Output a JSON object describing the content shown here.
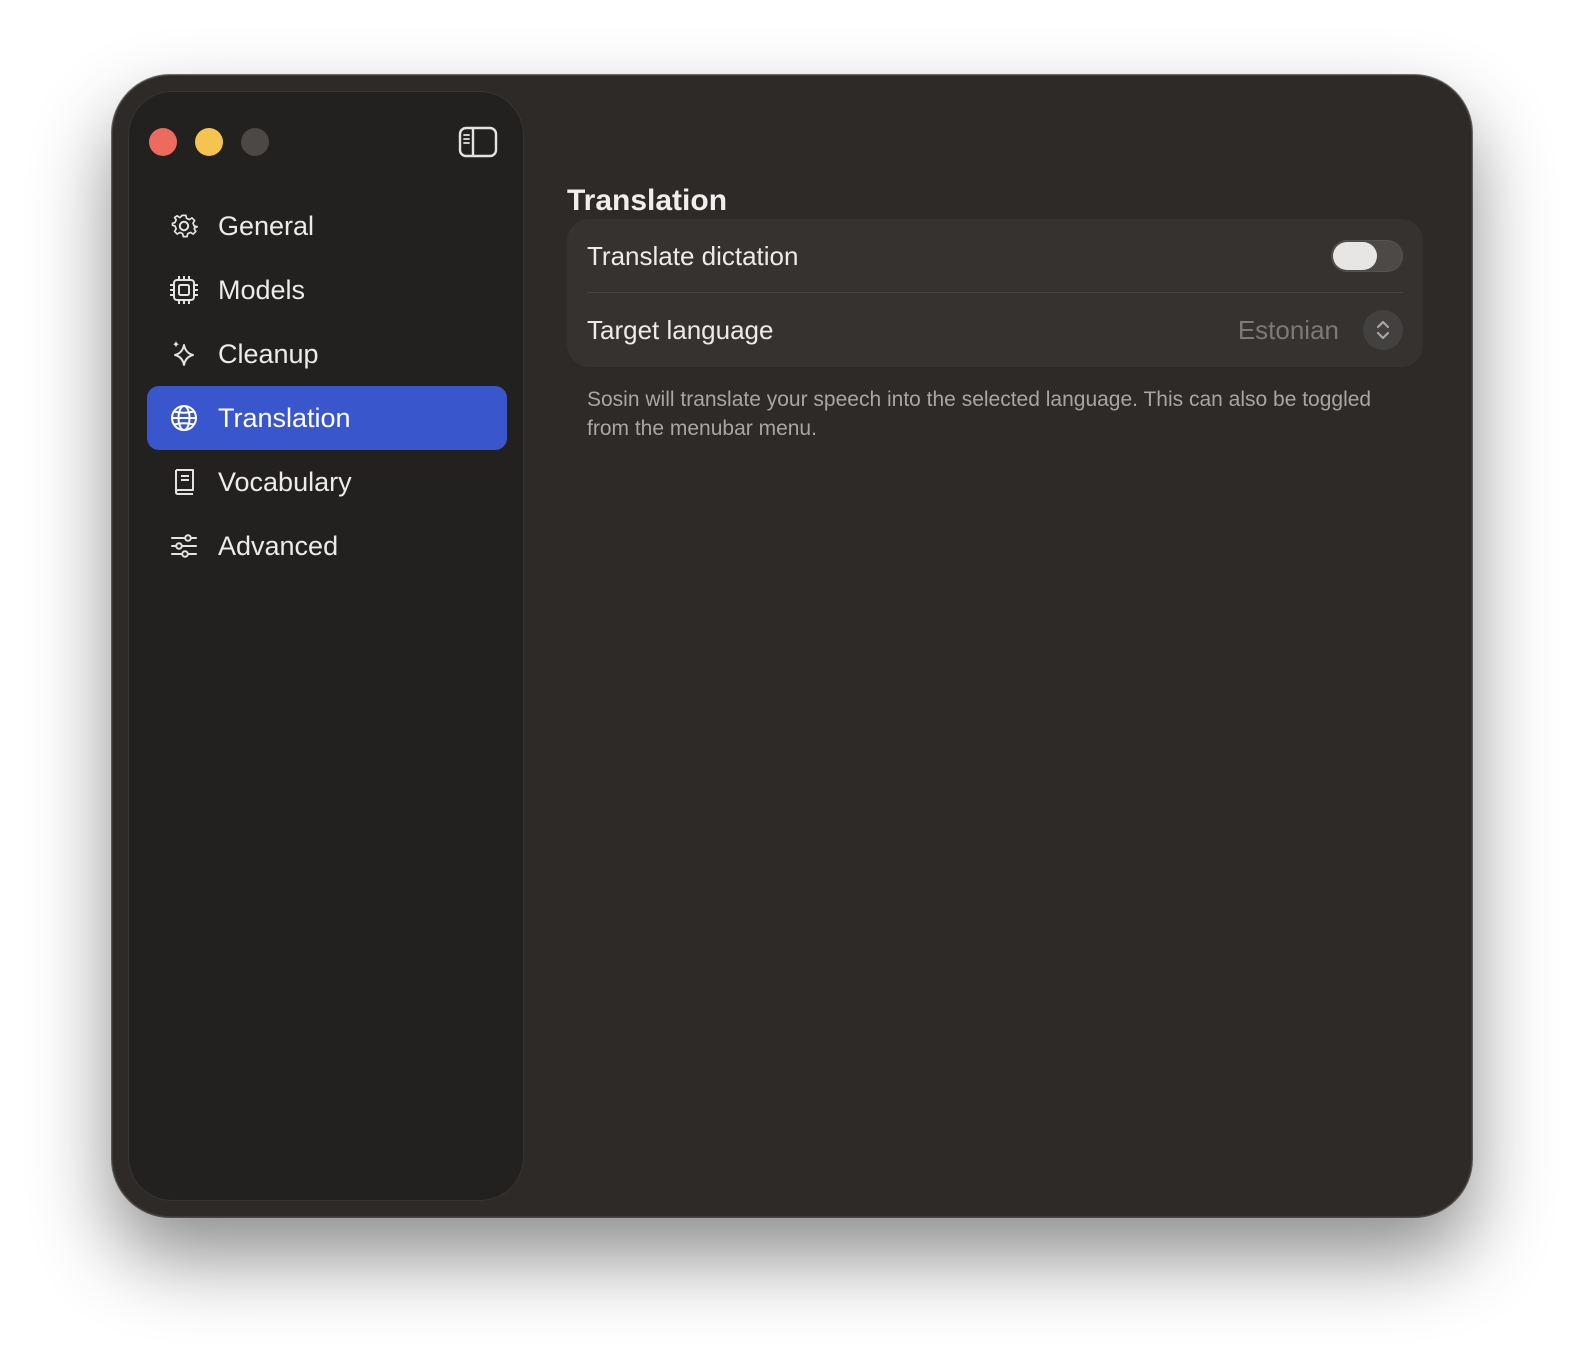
{
  "window": {
    "controls": {
      "close_color": "#ec6a5e",
      "minimize_color": "#f4c44f",
      "zoom_color": "#4b4845"
    },
    "sidebar_toggle_icon": "sidebar-left-icon"
  },
  "sidebar": {
    "accent_color": "#3a56cc",
    "items": [
      {
        "label": "General",
        "icon": "gear-icon",
        "active": false
      },
      {
        "label": "Models",
        "icon": "chip-icon",
        "active": false
      },
      {
        "label": "Cleanup",
        "icon": "sparkle-icon",
        "active": false
      },
      {
        "label": "Translation",
        "icon": "globe-icon",
        "active": true
      },
      {
        "label": "Vocabulary",
        "icon": "book-icon",
        "active": false
      },
      {
        "label": "Advanced",
        "icon": "sliders-icon",
        "active": false
      }
    ]
  },
  "main": {
    "title": "Translation",
    "settings": {
      "translate_dictation": {
        "label": "Translate dictation",
        "enabled": false
      },
      "target_language": {
        "label": "Target language",
        "value": "Estonian",
        "control_icon": "chevron-up-down-icon"
      }
    },
    "description": "Sosin will translate your speech into the selected language. This can also be toggled from the menubar menu."
  }
}
